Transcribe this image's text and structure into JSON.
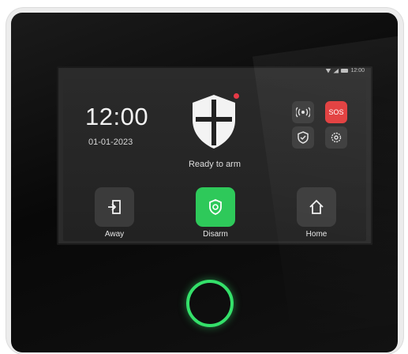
{
  "status_bar": {
    "time": "12:00",
    "icons": [
      "wifi-icon",
      "signal-icon",
      "battery-icon"
    ]
  },
  "clock": {
    "time": "12:00",
    "date": "01-01-2023"
  },
  "system": {
    "status_text": "Ready to arm",
    "alert_color": "#e63946"
  },
  "quick_actions": [
    {
      "name": "broadcast-icon",
      "label": "((•))"
    },
    {
      "name": "sos-button",
      "label": "SOS"
    },
    {
      "name": "shield-check-icon",
      "label": ""
    },
    {
      "name": "gear-icon",
      "label": ""
    }
  ],
  "modes": [
    {
      "label": "Away",
      "icon": "exit-door-icon",
      "active": false
    },
    {
      "label": "Disarm",
      "icon": "shield-disarm-icon",
      "active": true
    },
    {
      "label": "Home",
      "icon": "house-icon",
      "active": false
    }
  ],
  "colors": {
    "accent_green": "#2ec95a",
    "sos_red": "#e23b3b",
    "ring_green": "#34e06a"
  }
}
